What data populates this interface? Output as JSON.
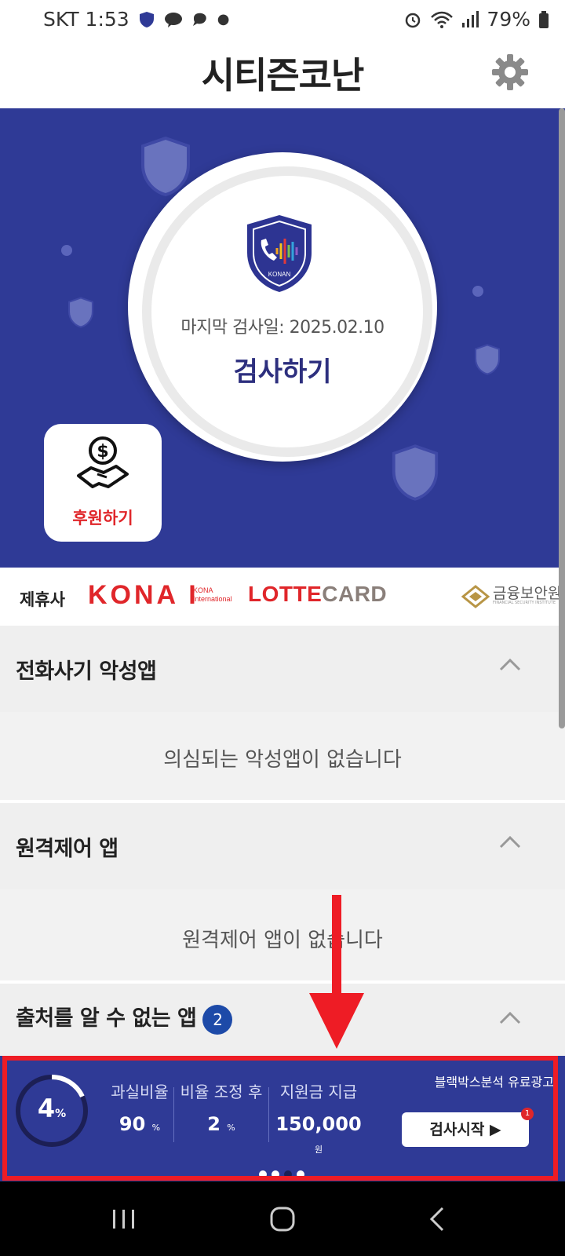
{
  "status_bar": {
    "carrier_time": "SKT 1:53",
    "battery": "79%"
  },
  "header": {
    "title": "시티즌코난"
  },
  "hero": {
    "last_scan": "마지막 검사일: 2025.02.10",
    "scan_label": "검사하기",
    "logo_text": "KONAN",
    "donate_label": "후원하기"
  },
  "partners": {
    "label": "제휴사",
    "kona": "KONA I",
    "kona_sub_1": "KONA",
    "kona_sub_2": "International",
    "lotte": "LOTTE",
    "lotte_card": "CARD",
    "fsi": "금융보안원",
    "fsi_sub": "FINANCIAL SECURITY INSTITUTE"
  },
  "sections": [
    {
      "title": "전화사기 악성앱",
      "message": "의심되는 악성앱이 없습니다"
    },
    {
      "title": "원격제어 앱",
      "message": "원격제어 앱이 없습니다"
    },
    {
      "title": "출처를 알 수 없는 앱",
      "badge": "2"
    }
  ],
  "ad": {
    "tag": "블랙박스분석 유료광고",
    "percent": "4",
    "percent_unit": "%",
    "stat1_label": "과실비율",
    "stat1_value": "90",
    "stat1_unit": "%",
    "stat2_label": "비율 조정 후",
    "stat2_value": "2",
    "stat2_unit": "%",
    "stat3_label": "지원금 지급",
    "stat3_value": "150,000",
    "stat3_unit": "원",
    "button": "검사시작 ▶",
    "button_badge": "1",
    "progress_fraction": 0.04
  },
  "colors": {
    "brand": "#2f3a96",
    "accent_red": "#e0262a",
    "badge_blue": "#1d4aa8"
  }
}
